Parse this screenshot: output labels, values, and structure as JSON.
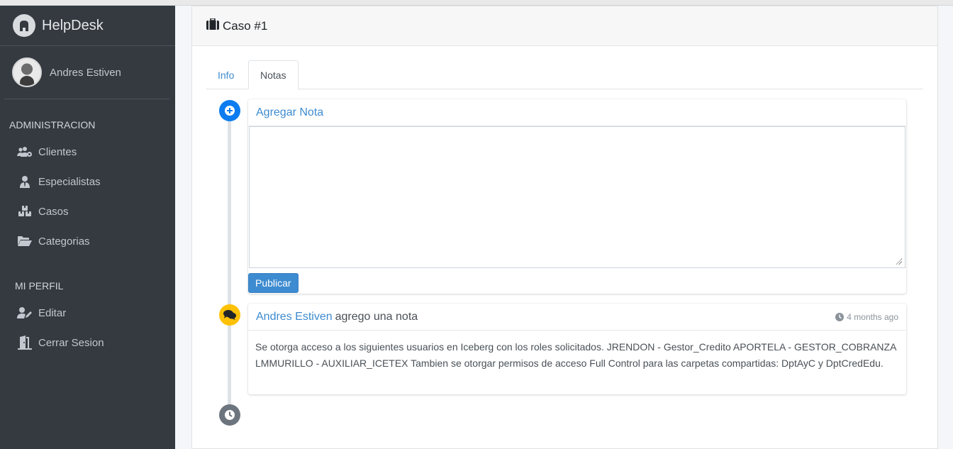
{
  "brand": {
    "name": "HelpDesk"
  },
  "user": {
    "name": "Andres Estiven"
  },
  "sidebar": {
    "admin_header": "ADMINISTRACION",
    "admin_items": [
      {
        "label": "Clientes",
        "icon": "users-cog-icon"
      },
      {
        "label": "Especialistas",
        "icon": "user-tie-icon"
      },
      {
        "label": "Casos",
        "icon": "boxes-icon"
      },
      {
        "label": "Categorias",
        "icon": "folder-open-icon"
      }
    ],
    "perfil_header": "MI PERFIL",
    "perfil_items": [
      {
        "label": "Editar",
        "icon": "user-edit-icon"
      },
      {
        "label": "Cerrar Sesion",
        "icon": "door-open-icon"
      }
    ]
  },
  "case": {
    "title": "Caso #1"
  },
  "tabs": [
    {
      "label": "Info",
      "active": false
    },
    {
      "label": "Notas",
      "active": true
    }
  ],
  "add_note": {
    "title": "Agregar Nota",
    "textarea_value": "",
    "button_label": "Publicar"
  },
  "note": {
    "author": "Andres Estiven",
    "action": "agrego una nota",
    "time": "4 months ago",
    "body": "Se otorga acceso a los siguientes usuarios en Iceberg con los roles solicitados. JRENDON - Gestor_Credito APORTELA - GESTOR_COBRANZA LMMURILLO - AUXILIAR_ICETEX Tambien se otorgar permisos de acceso Full Control para las carpetas compartidas: DptAyC y DptCredEdu."
  },
  "colors": {
    "sidebar_bg": "#343a40",
    "link": "#3d8bd0",
    "timeline_blue": "#0d7cf0",
    "timeline_yellow": "#ffc107",
    "timeline_gray": "#6c757d"
  }
}
